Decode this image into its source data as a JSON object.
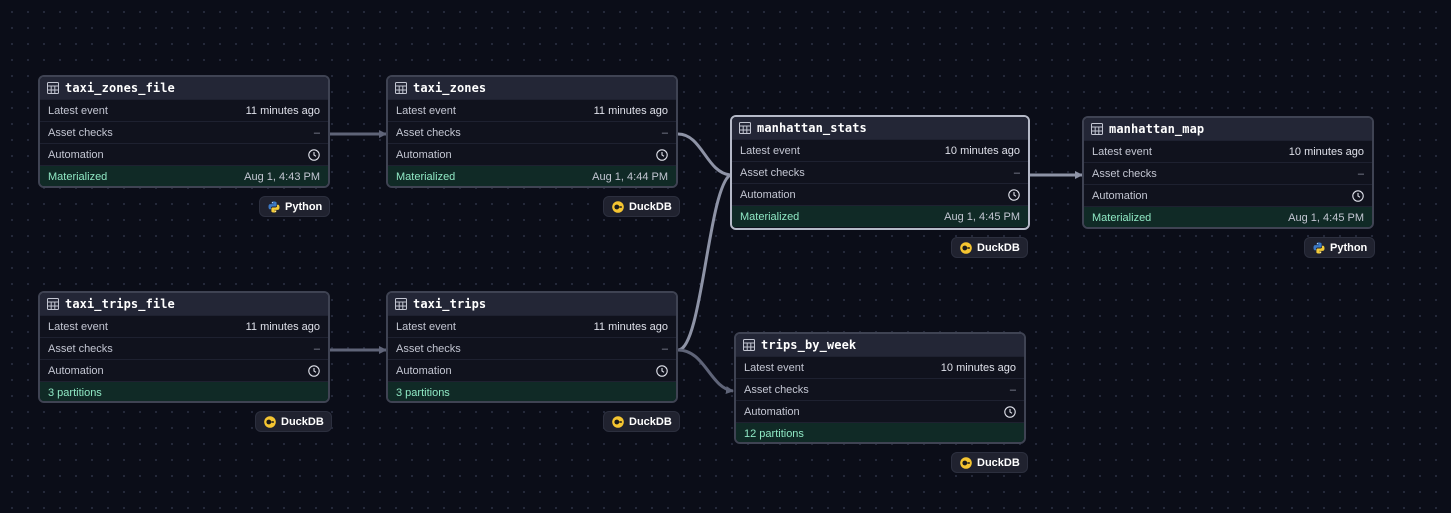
{
  "labels": {
    "latest_event": "Latest event",
    "asset_checks": "Asset checks",
    "automation": "Automation",
    "checks_value": "–"
  },
  "nodes": {
    "taxi_zones_file": {
      "name": "taxi_zones_file",
      "latest_event": "11 minutes ago",
      "status_label": "Materialized",
      "status_time": "Aug 1, 4:43 PM",
      "kind": "Python"
    },
    "taxi_zones": {
      "name": "taxi_zones",
      "latest_event": "11 minutes ago",
      "status_label": "Materialized",
      "status_time": "Aug 1, 4:44 PM",
      "kind": "DuckDB"
    },
    "manhattan_stats": {
      "name": "manhattan_stats",
      "latest_event": "10 minutes ago",
      "status_label": "Materialized",
      "status_time": "Aug 1, 4:45 PM",
      "kind": "DuckDB"
    },
    "manhattan_map": {
      "name": "manhattan_map",
      "latest_event": "10 minutes ago",
      "status_label": "Materialized",
      "status_time": "Aug 1, 4:45 PM",
      "kind": "Python"
    },
    "taxi_trips_file": {
      "name": "taxi_trips_file",
      "latest_event": "11 minutes ago",
      "status_label": "3 partitions",
      "kind": "DuckDB"
    },
    "taxi_trips": {
      "name": "taxi_trips",
      "latest_event": "11 minutes ago",
      "status_label": "3 partitions",
      "kind": "DuckDB"
    },
    "trips_by_week": {
      "name": "trips_by_week",
      "latest_event": "10 minutes ago",
      "status_label": "12 partitions",
      "kind": "DuckDB"
    }
  },
  "colors": {
    "canvas": "#0b0d18",
    "node_header": "#232636",
    "materialized_bg": "#102a26",
    "materialized_text": "#8fe8c4",
    "edge": "#5f6478",
    "edge_highlight": "#8e93a6",
    "duckdb_yellow": "#f5c531",
    "python_blue": "#3b78c4",
    "python_yellow": "#f2cb3a"
  }
}
